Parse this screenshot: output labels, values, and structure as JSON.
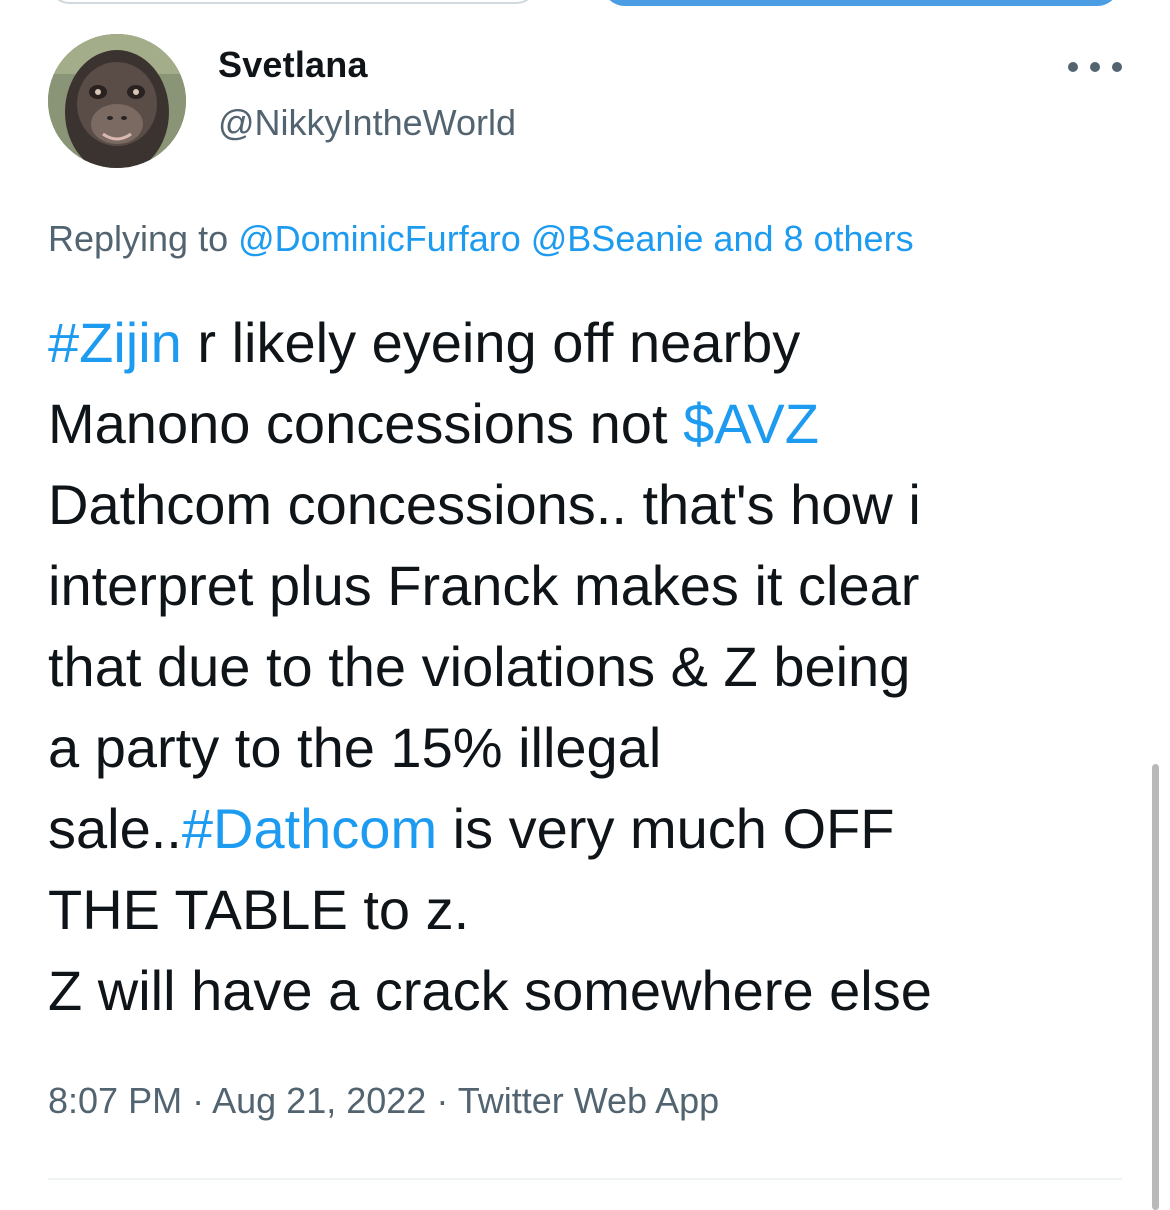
{
  "tweet": {
    "author_name": "Svetlana",
    "author_handle": "@NikkyIntheWorld",
    "replying_prefix": "Replying to",
    "replying_to": [
      "@DominicFurfaro",
      "@BSeanie"
    ],
    "replying_others": "and 8 others",
    "text": {
      "hashtag_1": "#Zijin",
      "line1_rest": " r likely eyeing off nearby",
      "line2_start": "Manono concessions not ",
      "cashtag": "$AVZ",
      "line3": "Dathcom concessions.. that's how i",
      "line4": "interpret plus Franck makes it clear",
      "line5": "that due to the violations & Z being",
      "line6": "a party to the 15% illegal",
      "line7_start": "sale..",
      "hashtag_2": "#Dathcom",
      "line7_rest": " is very much OFF",
      "line8": "THE TABLE to z.",
      "line9": "Z will have a crack somewhere else"
    },
    "time": "8:07 PM",
    "date": "Aug 21, 2022",
    "source": "Twitter Web App",
    "separator": "·"
  },
  "icons": {
    "more": "more-horizontal-icon"
  },
  "colors": {
    "link": "#1d9bf0",
    "secondary_text": "#536471",
    "primary_text": "#0f1419",
    "button_blue": "#4a9de3"
  }
}
